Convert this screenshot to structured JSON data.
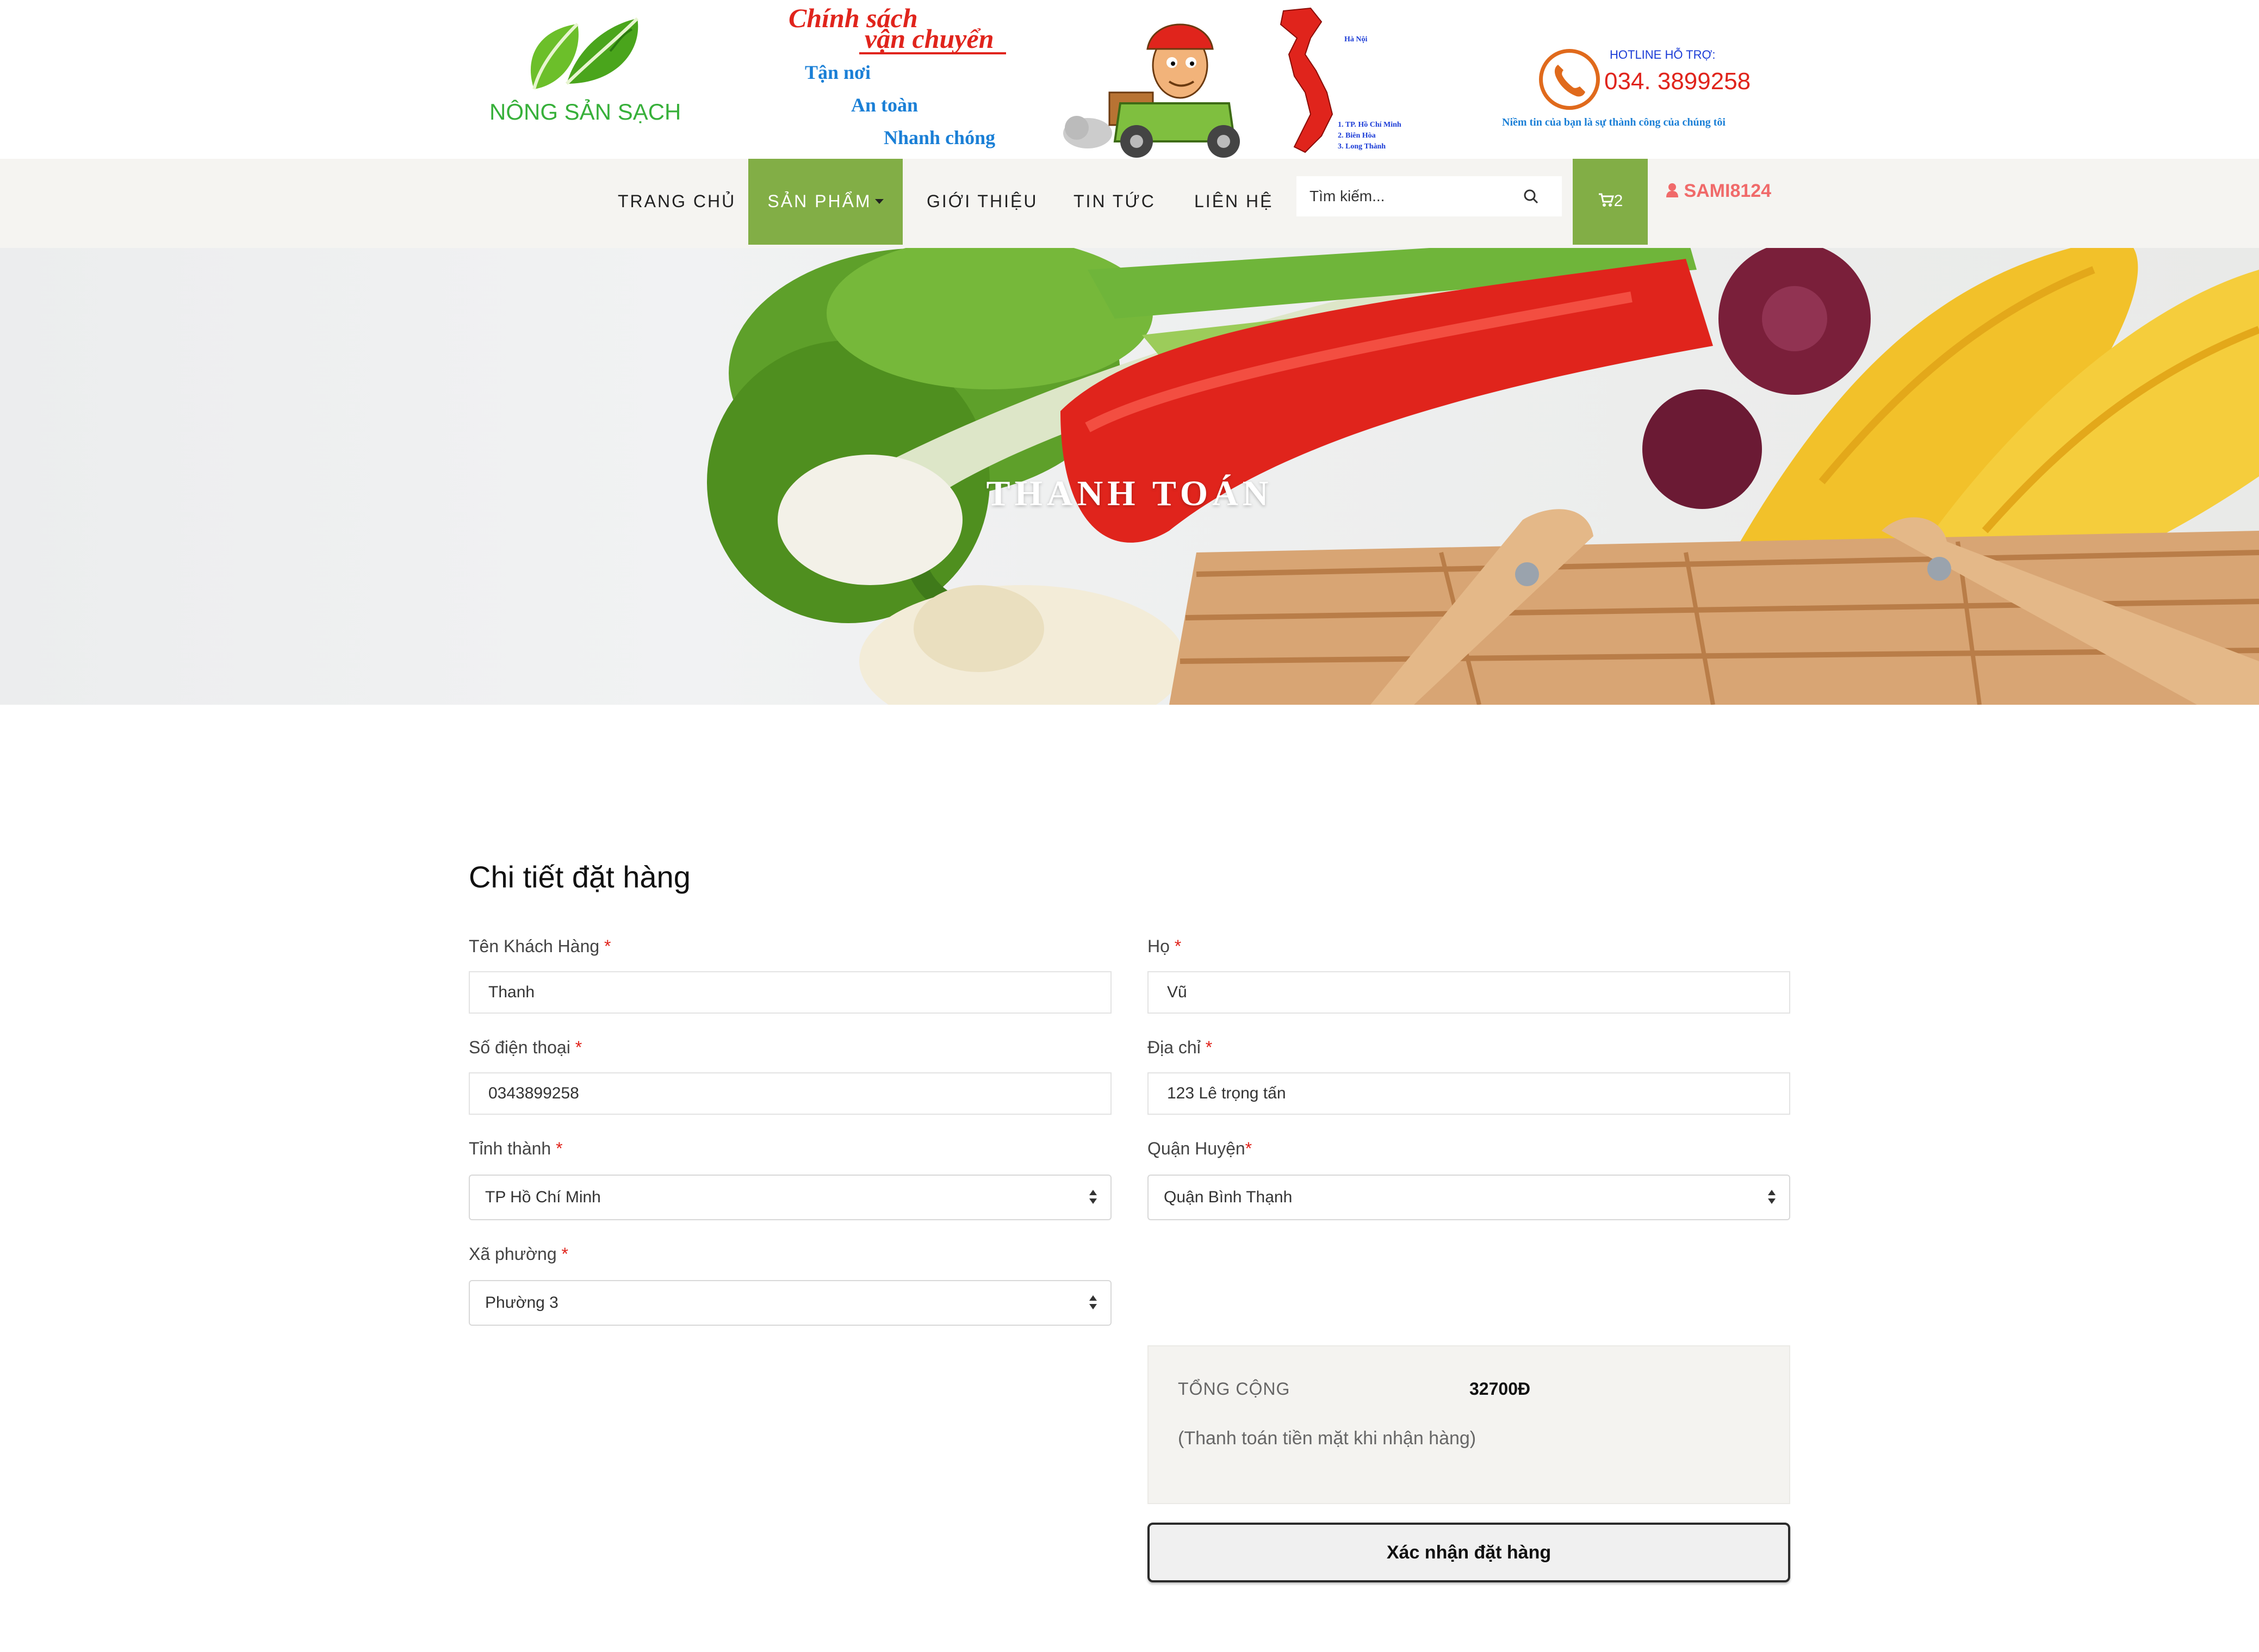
{
  "header": {
    "logo_text": "NÔNG SẢN SẠCH",
    "shipping_title_line1": "Chính sách",
    "shipping_title_line2": "vận chuyển",
    "shipping_lines": [
      "Tận nơi",
      "An toàn",
      "Nhanh chóng"
    ],
    "map_labels": [
      "Hà Nội",
      "1. TP. Hồ Chí Minh",
      "2. Biên Hòa",
      "3. Long Thành"
    ],
    "hotline_label": "HOTLINE HỖ TRỢ:",
    "hotline_number": "034. 3899258",
    "hotline_slogan": "Niềm tin của bạn là sự thành công của chúng tôi"
  },
  "nav": {
    "items": [
      {
        "label": "TRANG CHỦ",
        "active": false
      },
      {
        "label": "SẢN PHẨM",
        "active": true,
        "dropdown": true
      },
      {
        "label": "GIỚI THIỆU",
        "active": false
      },
      {
        "label": "TIN TỨC",
        "active": false
      },
      {
        "label": "LIÊN HỆ",
        "active": false
      }
    ],
    "search_placeholder": "Tìm kiếm...",
    "cart_count": "2",
    "username": "SAMI8124"
  },
  "hero": {
    "title": "THANH TOÁN"
  },
  "form": {
    "title": "Chi tiết đặt hàng",
    "first_name": {
      "label": "Tên Khách Hàng",
      "value": "Thanh"
    },
    "last_name": {
      "label": "Họ",
      "value": "Vũ"
    },
    "phone": {
      "label": "Số điện thoại",
      "value": "0343899258"
    },
    "address": {
      "label": "Địa chỉ",
      "value": "123 Lê trọng tấn"
    },
    "province": {
      "label": "Tỉnh thành",
      "value": "TP Hồ Chí Minh"
    },
    "district": {
      "label": "Quận Huyện",
      "value": "Quận Bình Thạnh"
    },
    "ward": {
      "label": "Xã phường",
      "value": "Phường 3"
    },
    "required_mark": "*"
  },
  "summary": {
    "total_label": "TỔNG CỘNG",
    "total_value": "32700Đ",
    "payment_note": "(Thanh toán tiền mặt khi nhận hàng)"
  },
  "confirm_label": "Xác nhận đặt hàng",
  "colors": {
    "accent_green": "#82ae46",
    "nav_bg": "#f5f4f1",
    "user_color": "#f06a6a",
    "required_red": "#e0241c"
  }
}
